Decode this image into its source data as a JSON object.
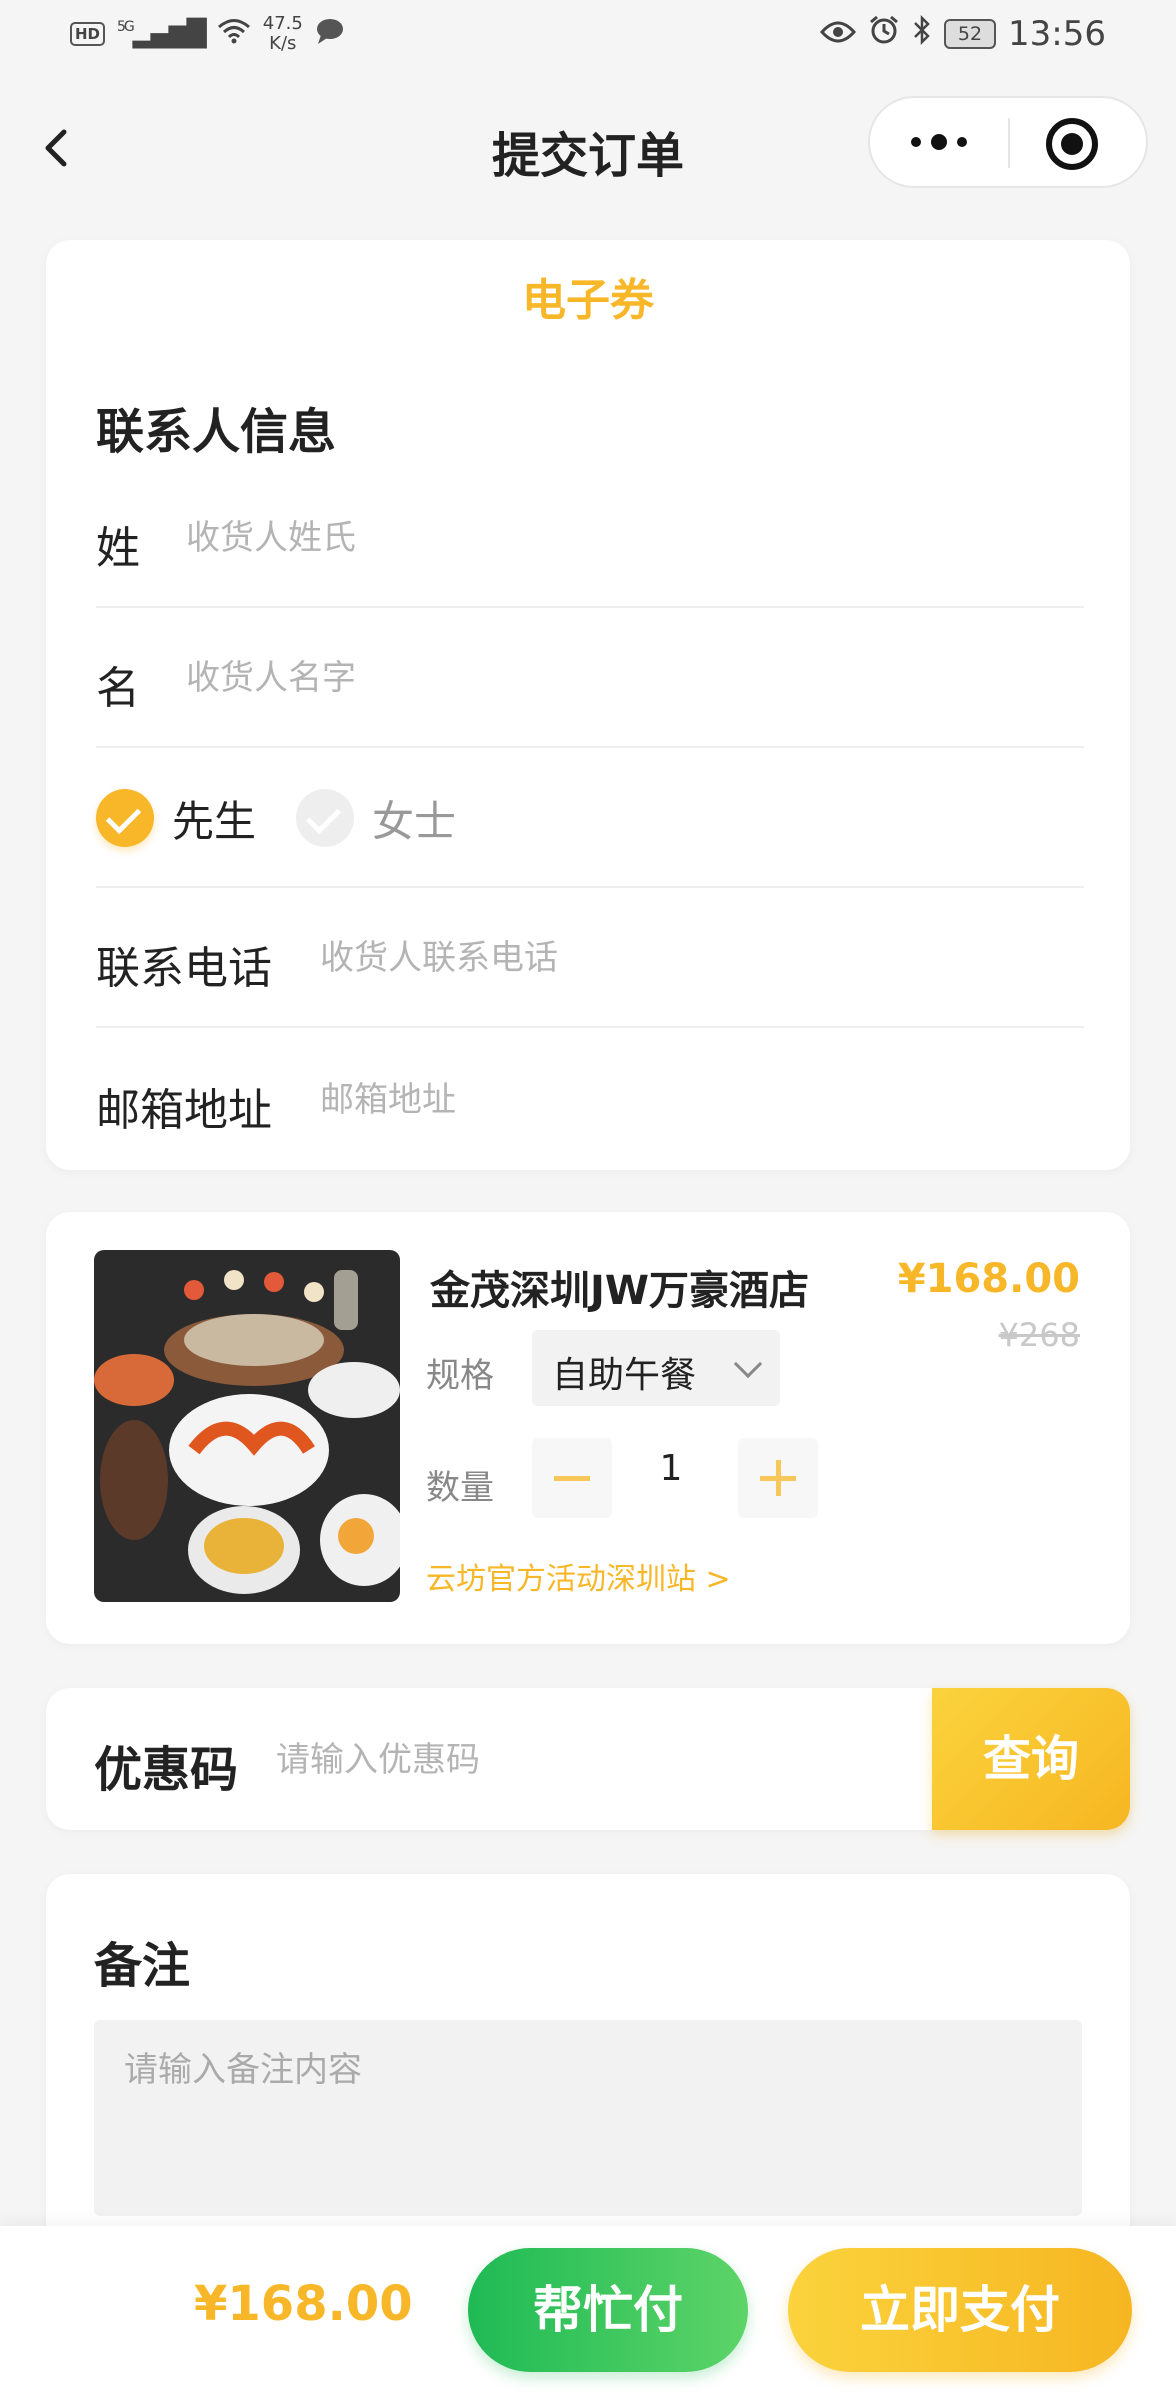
{
  "status_bar": {
    "hd": "HD",
    "network": "5G",
    "speed_value": "47.5",
    "speed_unit": "K/s",
    "battery": "52",
    "time": "13:56"
  },
  "nav": {
    "title": "提交订单"
  },
  "contact": {
    "tag": "电子券",
    "section_title": "联系人信息",
    "last_name_label": "姓",
    "last_name_placeholder": "收货人姓氏",
    "first_name_label": "名",
    "first_name_placeholder": "收货人名字",
    "gender_options": [
      "先生",
      "女士"
    ],
    "gender_selected": "先生",
    "phone_label": "联系电话",
    "phone_placeholder": "收货人联系电话",
    "email_label": "邮箱地址",
    "email_placeholder": "邮箱地址"
  },
  "product": {
    "image_alt": "自助餐海鲜图片",
    "title": "金茂深圳JW万豪酒店",
    "price": "¥168.00",
    "original_price": "¥268",
    "spec_label": "规格",
    "spec_value": "自助午餐",
    "qty_label": "数量",
    "qty_value": "1",
    "shop_link": "云坊官方活动深圳站 >"
  },
  "coupon": {
    "label": "优惠码",
    "placeholder": "请输入优惠码",
    "button": "查询"
  },
  "remark": {
    "title": "备注",
    "placeholder": "请输入备注内容"
  },
  "bottom": {
    "total": "¥168.00",
    "help_pay": "帮忙付",
    "pay_now": "立即支付"
  },
  "colors": {
    "accent": "#f7b728",
    "green": "#1fba55",
    "background": "#f5f5f5"
  },
  "icons": [
    "back-icon",
    "more-icon",
    "close-mini-program-icon",
    "check-icon",
    "chevron-down-icon",
    "minus-icon",
    "plus-icon",
    "wifi-icon",
    "eye-icon",
    "alarm-icon",
    "bluetooth-icon",
    "message-icon"
  ]
}
